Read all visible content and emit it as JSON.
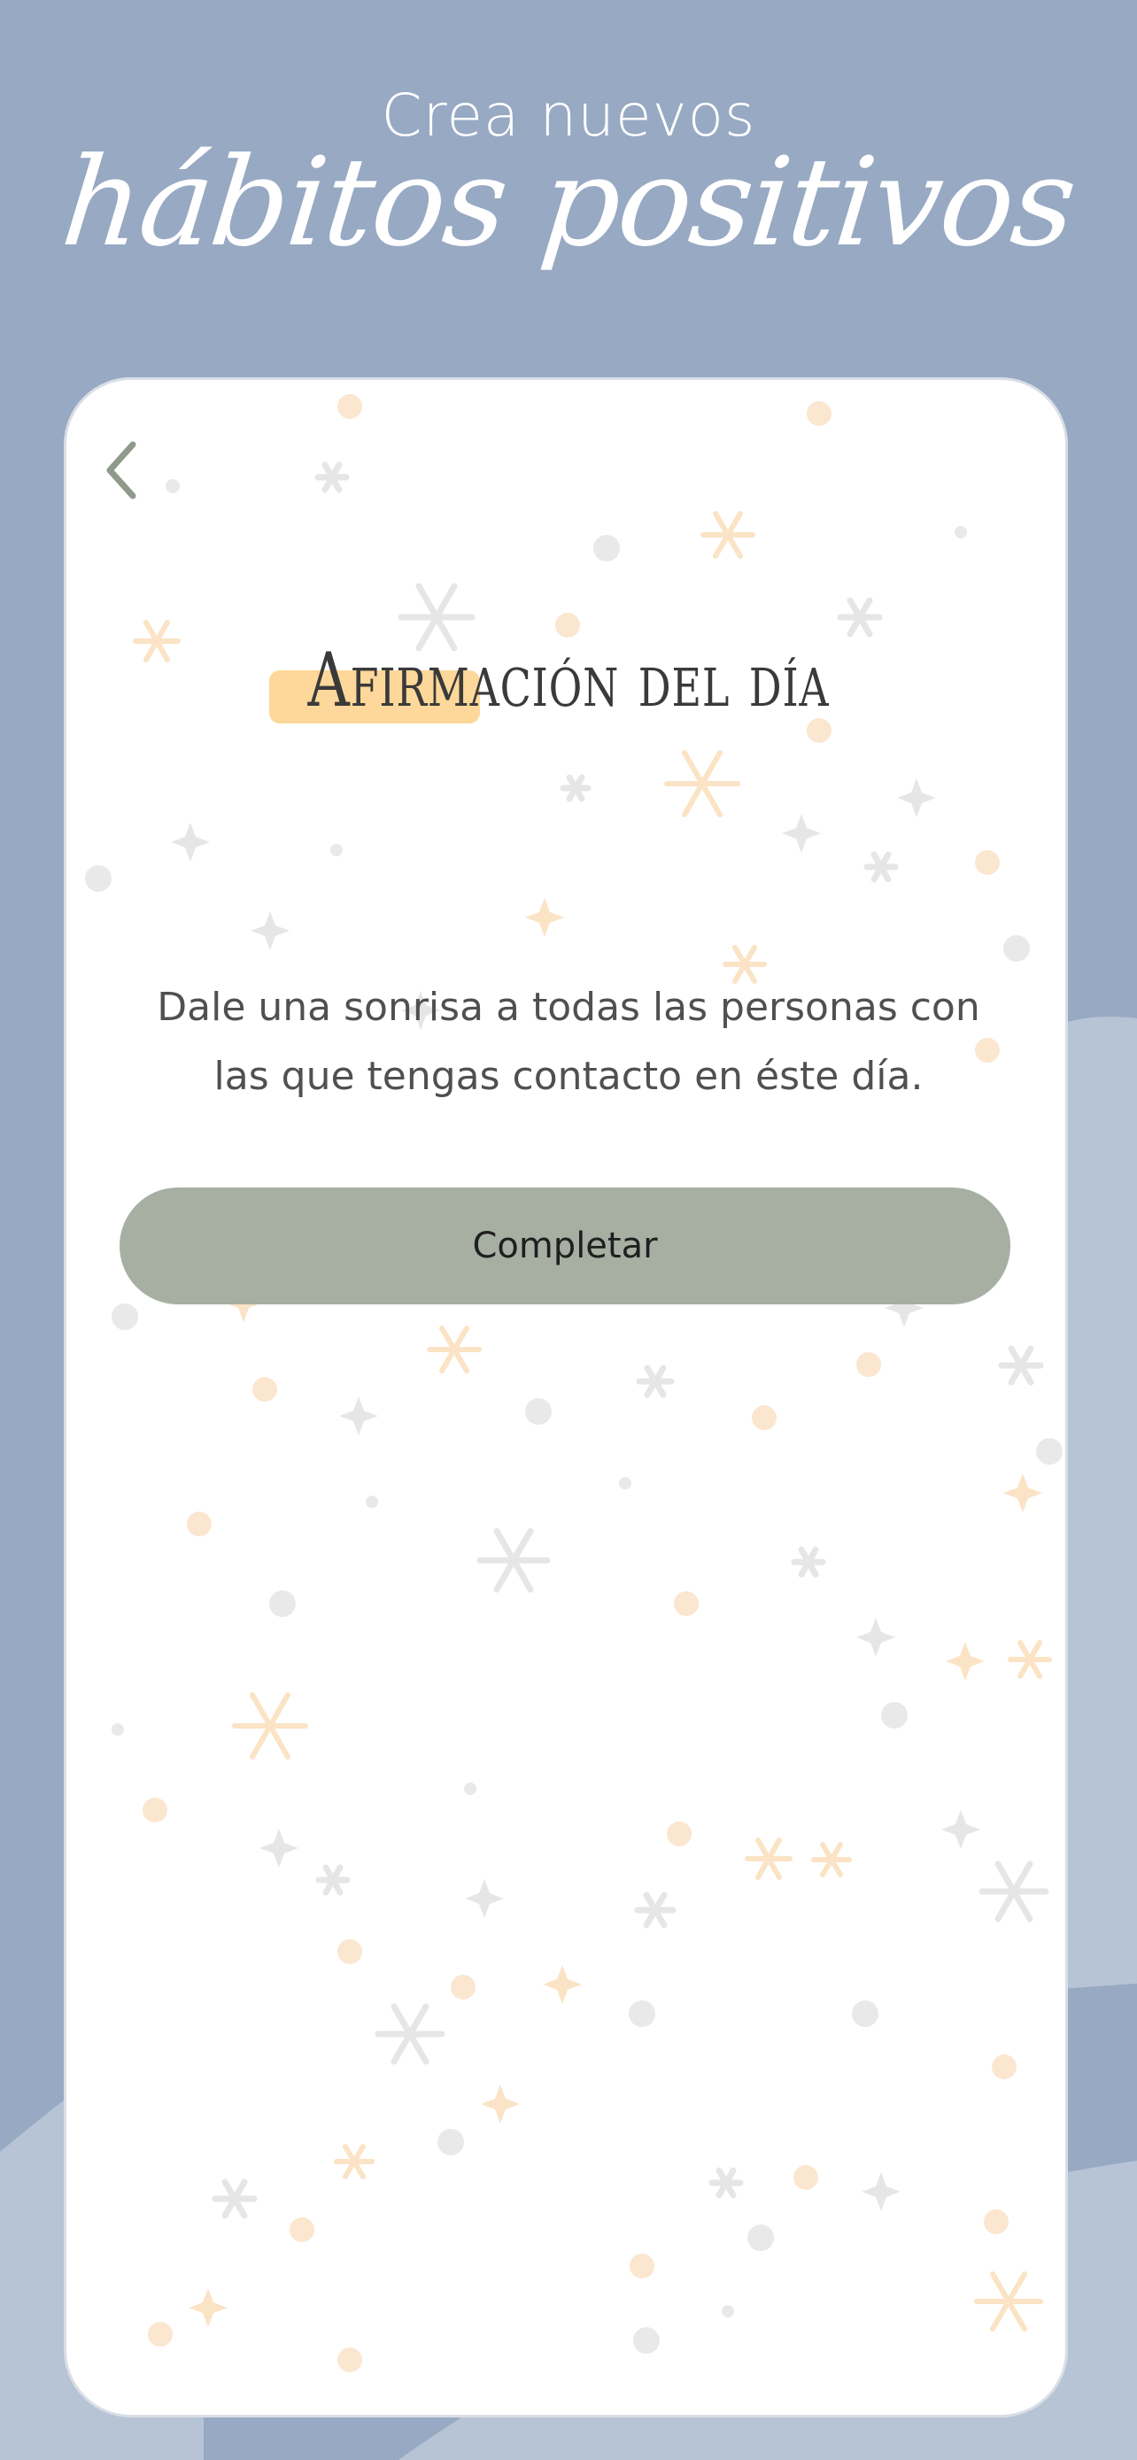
{
  "header": {
    "subtitle": "Crea nuevos",
    "title": "hábitos positivos"
  },
  "card": {
    "back_icon": "chevron-left-icon",
    "heading": "Afirmación del día",
    "affirmation": "Dale una sonrisa a todas las personas con las que tengas contacto en éste día.",
    "complete_label": "Completar"
  },
  "colors": {
    "background": "#97a9c3",
    "background_wave": "#b7c4d5",
    "card": "#ffffff",
    "button": "#a6afa2",
    "highlight": "#fdd89a",
    "back_icon": "#8f9a8b"
  }
}
